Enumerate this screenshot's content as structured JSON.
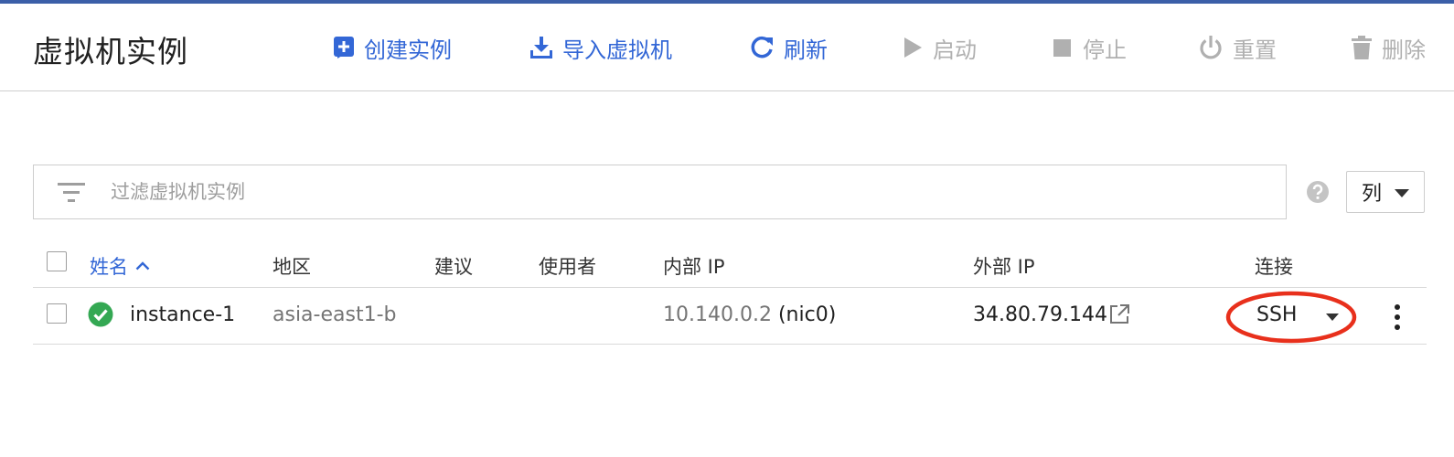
{
  "header": {
    "title": "虚拟机实例",
    "actions": {
      "create": "创建实例",
      "import": "导入虚拟机",
      "refresh": "刷新",
      "start": "启动",
      "stop": "停止",
      "reset": "重置",
      "delete": "删除"
    }
  },
  "filter": {
    "placeholder": "过滤虚拟机实例",
    "icon": "filter-list-icon"
  },
  "columns_button": {
    "label": "列"
  },
  "table": {
    "headers": {
      "name": "姓名",
      "zone": "地区",
      "recommendation": "建议",
      "used_by": "使用者",
      "internal_ip": "内部 IP",
      "external_ip": "外部 IP",
      "connect": "连接"
    },
    "rows": [
      {
        "status": "running",
        "name": "instance-1",
        "zone": "asia-east1-b",
        "recommendation": "",
        "used_by": "",
        "internal_ip": "10.140.0.2",
        "internal_nic": "(nic0)",
        "external_ip": "34.80.79.144",
        "connect": "SSH"
      }
    ]
  },
  "colors": {
    "accent": "#3367d6",
    "disabled": "#b0b0b0",
    "status_ok": "#34a853",
    "annotation": "#e8301c",
    "top_bar": "#3b5fa8"
  }
}
